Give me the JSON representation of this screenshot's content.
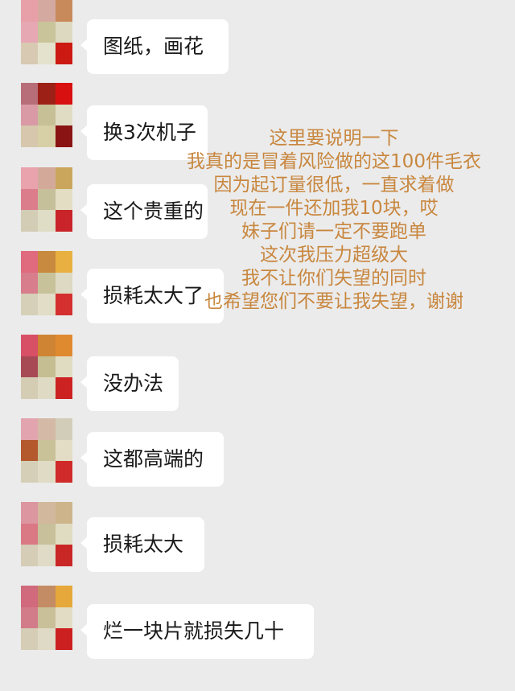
{
  "colors": {
    "background": "#ebebeb",
    "bubble": "#ffffff",
    "overlay_text": "#c8873f"
  },
  "messages": [
    {
      "text": "图纸，画花",
      "avatar_colors": [
        "#e8a0a8",
        "#d4a9a0",
        "#c88a5a",
        "#e6a8b2",
        "#c9c49a",
        "#ddd9c0",
        "#d8c9b3",
        "#e4e2cc",
        "#cc1a12"
      ]
    },
    {
      "text": "换3次机子",
      "avatar_colors": [
        "#b86e78",
        "#9c2016",
        "#d81010",
        "#d99aa5",
        "#c7bf96",
        "#e0dcc4",
        "#d6c7ad",
        "#d7cfa6",
        "#8a1414"
      ]
    },
    {
      "text": "这个贵重的",
      "avatar_colors": [
        "#e8a3ad",
        "#d3aa9a",
        "#caa65c",
        "#dc7d8c",
        "#c6c09a",
        "#e2ddc3",
        "#d3cdb6",
        "#e0ddc6",
        "#c8242a"
      ]
    },
    {
      "text": "损耗太大了",
      "avatar_colors": [
        "#e06a7e",
        "#c88a3e",
        "#e8b040",
        "#d87d8c",
        "#c8c29a",
        "#ddd9c2",
        "#d6d0b8",
        "#e1ddc6",
        "#d43030"
      ]
    },
    {
      "text": "没办法",
      "avatar_colors": [
        "#d85066",
        "#cf8434",
        "#e08a30",
        "#a84a56",
        "#c5be92",
        "#e0dcc2",
        "#d4cdb4",
        "#dfdac4",
        "#cc2222"
      ]
    },
    {
      "text": "这都高端的",
      "avatar_colors": [
        "#e2a4ae",
        "#d4b9a6",
        "#d2cdb8",
        "#b4582e",
        "#c9c198",
        "#e2ddc4",
        "#d6cfb7",
        "#e0dbc5",
        "#d02a2a"
      ]
    },
    {
      "text": "损耗太大",
      "avatar_colors": [
        "#dc96a0",
        "#d2b89c",
        "#cdb48a",
        "#da7884",
        "#c8c09a",
        "#e0dcc2",
        "#d5cdb6",
        "#e0dbc6",
        "#c92626"
      ]
    },
    {
      "text": "烂一块片就损失几十",
      "avatar_colors": [
        "#d06a7c",
        "#c48c64",
        "#e6a83a",
        "#d27c8a",
        "#c9c09a",
        "#e1dcc3",
        "#d5cdb5",
        "#dfdac5",
        "#cc2020"
      ]
    }
  ],
  "overlay_lines": [
    "这里要说明一下",
    "我真的是冒着风险做的这100件毛衣",
    "因为起订量很低，一直求着做",
    "现在一件还加我10块，哎",
    "妹子们请一定不要跑单",
    "这次我压力超级大",
    "我不让你们失望的同时",
    "也希望您们不要让我失望，谢谢"
  ]
}
